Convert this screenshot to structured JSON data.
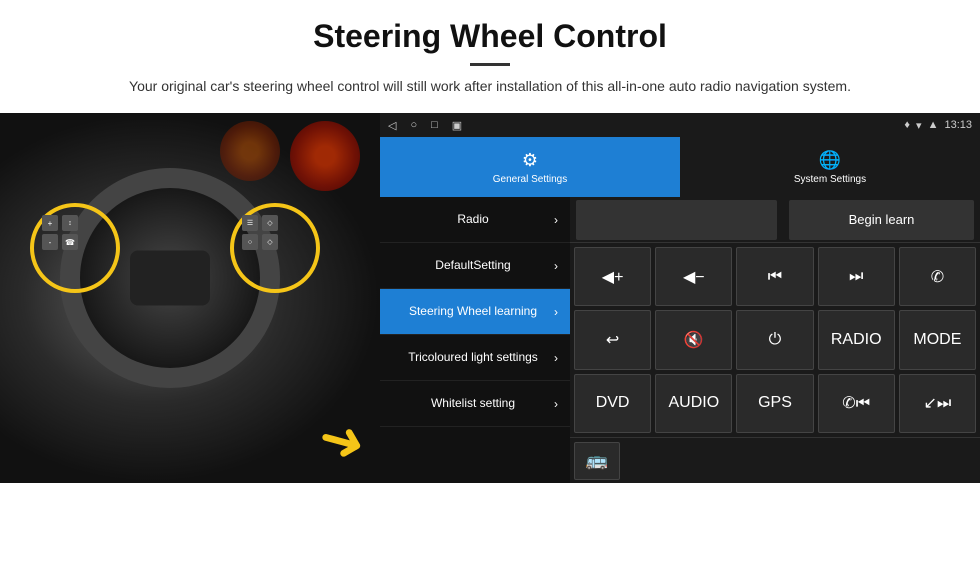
{
  "header": {
    "title": "Steering Wheel Control",
    "divider": true,
    "subtitle": "Your original car's steering wheel control will still work after installation of this all-in-one auto radio navigation system."
  },
  "status_bar": {
    "nav_icons": [
      "◁",
      "○",
      "□",
      "▣"
    ],
    "wifi_icon": "▾",
    "signal_icon": "▾",
    "time": "13:13"
  },
  "tabs": [
    {
      "id": "general",
      "icon": "⚙",
      "label": "General Settings",
      "active": true
    },
    {
      "id": "system",
      "icon": "🌐",
      "label": "System Settings",
      "active": false
    }
  ],
  "menu_items": [
    {
      "id": "radio",
      "label": "Radio",
      "active": false
    },
    {
      "id": "default",
      "label": "DefaultSetting",
      "active": false
    },
    {
      "id": "steering",
      "label": "Steering Wheel learning",
      "active": true
    },
    {
      "id": "tricoloured",
      "label": "Tricoloured light settings",
      "active": false
    },
    {
      "id": "whitelist",
      "label": "Whitelist setting",
      "active": false
    }
  ],
  "top_row": {
    "begin_learn_label": "Begin learn"
  },
  "control_rows": [
    [
      {
        "id": "vol-up",
        "display": "◀+",
        "label": "volume up"
      },
      {
        "id": "vol-down",
        "display": "◀-",
        "label": "volume down"
      },
      {
        "id": "prev",
        "display": "⏮",
        "label": "previous"
      },
      {
        "id": "next",
        "display": "⏭",
        "label": "next"
      },
      {
        "id": "phone",
        "display": "✆",
        "label": "phone"
      }
    ],
    [
      {
        "id": "hook",
        "display": "↩",
        "label": "hook"
      },
      {
        "id": "mute",
        "display": "🔇",
        "label": "mute"
      },
      {
        "id": "power",
        "display": "⏻",
        "label": "power"
      },
      {
        "id": "radio-btn",
        "display": "RADIO",
        "label": "radio"
      },
      {
        "id": "mode",
        "display": "MODE",
        "label": "mode"
      }
    ],
    [
      {
        "id": "dvd",
        "display": "DVD",
        "label": "dvd"
      },
      {
        "id": "audio",
        "display": "AUDIO",
        "label": "audio"
      },
      {
        "id": "gps",
        "display": "GPS",
        "label": "gps"
      },
      {
        "id": "phone2",
        "display": "✆⏮",
        "label": "phone prev"
      },
      {
        "id": "next2",
        "display": "↙⏭",
        "label": "next2"
      }
    ]
  ],
  "bottom_row": {
    "icon": "🚌"
  }
}
